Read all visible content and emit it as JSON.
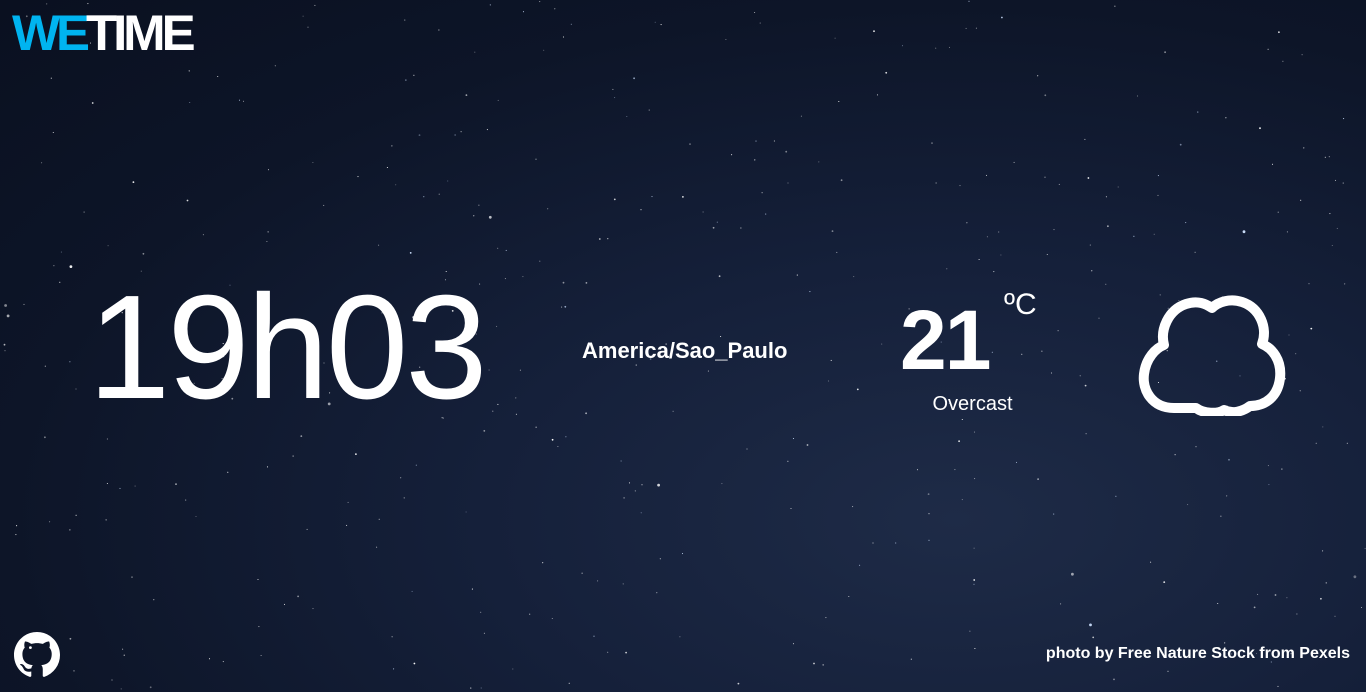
{
  "logo": {
    "part1": "WE",
    "part2": "TIME",
    "accent_color": "#00b4f0",
    "text_color": "#ffffff"
  },
  "clock": {
    "time": "19h03"
  },
  "location": {
    "timezone": "America/Sao_Paulo"
  },
  "weather": {
    "temperature": "21",
    "unit": "ºC",
    "condition": "Overcast",
    "icon": "cloud-icon"
  },
  "footer": {
    "github_icon": "github-icon",
    "credit": "photo by Free Nature Stock from Pexels"
  },
  "background": {
    "color_dark": "#0a1020",
    "color_light": "#1e2b47"
  }
}
